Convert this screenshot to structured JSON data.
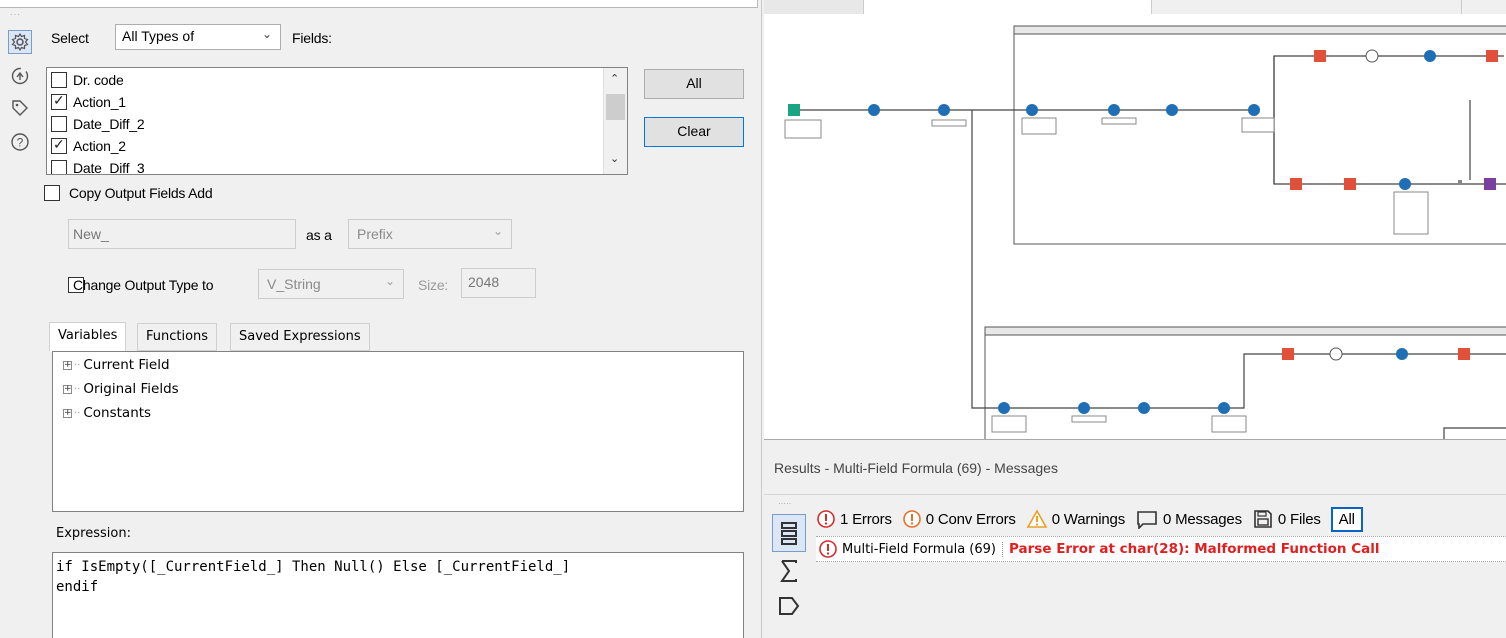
{
  "config": {
    "select_label": "Select",
    "type_value": "All Types of",
    "fields_label": "Fields:",
    "fields": [
      {
        "name": "Dr. code",
        "checked": false
      },
      {
        "name": "Action_1",
        "checked": true
      },
      {
        "name": "Date_Diff_2",
        "checked": false
      },
      {
        "name": "Action_2",
        "checked": true
      },
      {
        "name": "Date_Diff_3",
        "checked": false
      }
    ],
    "all_button": "All",
    "clear_button": "Clear",
    "copy_output_label": "Copy Output Fields Add",
    "copy_output_checked": false,
    "prefix_value": "New_",
    "as_a_label": "as a",
    "position_value": "Prefix",
    "change_type_label": "Change Output Type to",
    "change_type_checked": false,
    "type_select_value": "V_String",
    "size_label": "Size:",
    "size_value": "2048"
  },
  "tabs": [
    {
      "label": "Variables",
      "active": true
    },
    {
      "label": "Functions",
      "active": false
    },
    {
      "label": "Saved Expressions",
      "active": false
    }
  ],
  "tree": [
    "Current Field",
    "Original Fields",
    "Constants"
  ],
  "expression": {
    "label": "Expression:",
    "text": "if IsEmpty([_CurrentField_] Then Null() Else [_CurrentField_]\nendif"
  },
  "results": {
    "title": "Results - Multi-Field Formula (69) - Messages",
    "filters": [
      {
        "icon": "error-icon",
        "label": "1 Errors"
      },
      {
        "icon": "conv-error-icon",
        "label": "0 Conv Errors"
      },
      {
        "icon": "warning-icon",
        "label": "0 Warnings"
      },
      {
        "icon": "message-icon",
        "label": "0 Messages"
      },
      {
        "icon": "file-icon",
        "label": "0 Files"
      }
    ],
    "all_label": "All",
    "message": {
      "tool": "Multi-Field Formula (69)",
      "text": "Parse Error at char(28): Malformed Function Call"
    },
    "colors": {
      "error": "#e02020",
      "accent": "#0a64c8"
    }
  }
}
